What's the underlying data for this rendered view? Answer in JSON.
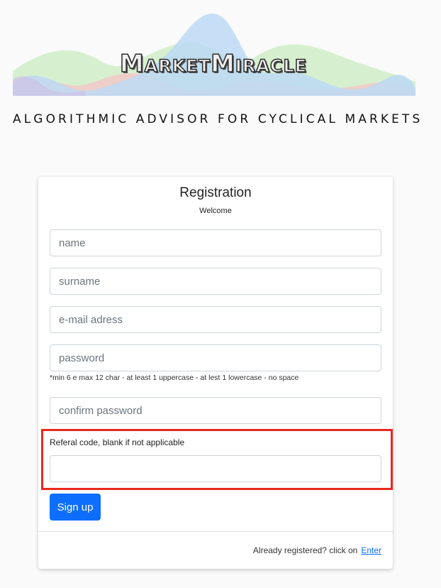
{
  "header": {
    "logo_text": "MarketMiracle",
    "tagline": "ALGORITHMIC ADVISOR FOR CYCLICAL MARKETS"
  },
  "form": {
    "title": "Registration",
    "subtitle": "Welcome",
    "name_placeholder": "name",
    "surname_placeholder": "surname",
    "email_placeholder": "e-mail adress",
    "password_placeholder": "password",
    "password_hint": "*min 6 e max 12 char - at least 1 uppercase - at lest 1 lowercase - no space",
    "confirm_password_placeholder": "confirm password",
    "referral_label": "Referal code, blank if not applicable",
    "referral_value": "",
    "signup_label": "Sign up"
  },
  "footer": {
    "text": "Already registered? click on",
    "link_label": "Enter"
  },
  "colors": {
    "primary": "#0d6efd",
    "highlight": "#e8291c",
    "wave_blue": "#bcd9f5",
    "wave_green": "#c9ecc0",
    "wave_red": "#f4c6c6"
  }
}
